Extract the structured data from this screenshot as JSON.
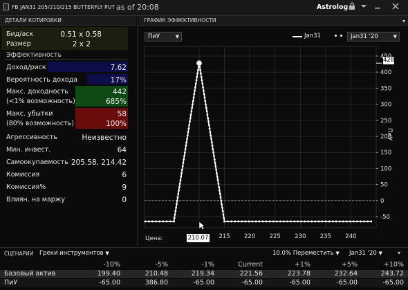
{
  "window": {
    "title": "FB JAN31 205/210/215 BUTTERFLY PUT",
    "as_of": "as of 20:08",
    "app_name": "Astrolog",
    "lock_icon": "lock-icon",
    "dropdown_icon": "chevron-down-icon",
    "minimize_icon": "minimize-icon",
    "close_icon": "close-icon"
  },
  "details": {
    "header": "ДЕТАЛИ КОТИРОВКИ",
    "bid_ask_label": "Бид/аск",
    "bid_ask_value": "0.51 x 0.58",
    "size_label": "Размер",
    "size_value": "2 x 2",
    "perf_section": "Эффективность",
    "income_risk_label": "Доход/риск",
    "income_risk_value": "7.62",
    "prob_profit_label": "Вероятность дохода",
    "prob_profit_value": "17%",
    "max_profit_label": "Макс. доходность",
    "max_profit_value": "442",
    "max_profit_prob_label": "(<1% возможность)",
    "max_profit_prob_value": "685%",
    "max_loss_label": "Макс. убытки",
    "max_loss_value": "58",
    "max_loss_prob_label": "(80% возможность)",
    "max_loss_prob_value": "100%",
    "aggressiveness_label": "Агрессивность",
    "aggressiveness_value": "Неизвестно",
    "min_invest_label": "Мин. инвест.",
    "min_invest_value": "64",
    "breakeven_label": "Самоокупаемость",
    "breakeven_value": "205.58, 214.42",
    "commission_label": "Комиссия",
    "commission_value": "6",
    "commission_pct_label": "Комиссия%",
    "commission_pct_value": "9",
    "margin_impact_label": "Влиян. на маржу",
    "margin_impact_value": "0"
  },
  "chart_panel": {
    "header": "ГРАФИК ЭФФЕКТИВНОСТИ",
    "mode_select": "ПиУ",
    "legend_solid": "Jan31",
    "legend_dotted_select": "Jan31 '20",
    "price_label": "Цена:",
    "cursor_price": "210.07",
    "ylabel": "ПиУ",
    "peak_label": "428"
  },
  "chart_data": {
    "type": "line",
    "series": [
      {
        "name": "Jan31",
        "x": [
          200,
          205,
          210,
          215,
          244
        ],
        "y": [
          -65,
          -65,
          428,
          -65,
          -65
        ]
      }
    ],
    "xticks": [
      215,
      220,
      225,
      230,
      235,
      240
    ],
    "yticks": [
      450,
      400,
      350,
      300,
      250,
      200,
      150,
      100,
      50,
      0,
      -50
    ],
    "xlim": [
      200,
      244
    ],
    "ylim": [
      -90,
      460
    ],
    "peak": {
      "x": 210,
      "y": 428
    },
    "grid": true,
    "zero_line": true
  },
  "scenarios": {
    "header": "СЦЕНАРИИ",
    "greeks_select": "Греки инструментов",
    "move_select": "10.0% Переместить",
    "expiry_select": "Jan31 '20",
    "columns": [
      "-10%",
      "-5%",
      "-1%",
      "Current",
      "+1%",
      "+5%",
      "+10%"
    ],
    "rows": [
      {
        "name": "Базовый актив",
        "values": [
          "199.40",
          "210.48",
          "219.34",
          "221.56",
          "223.78",
          "232.64",
          "243.72"
        ]
      },
      {
        "name": "ПиУ",
        "values": [
          "-65.00",
          "386.80",
          "-65.00",
          "-65.00",
          "-65.00",
          "-65.00",
          "-65.00"
        ]
      }
    ]
  }
}
